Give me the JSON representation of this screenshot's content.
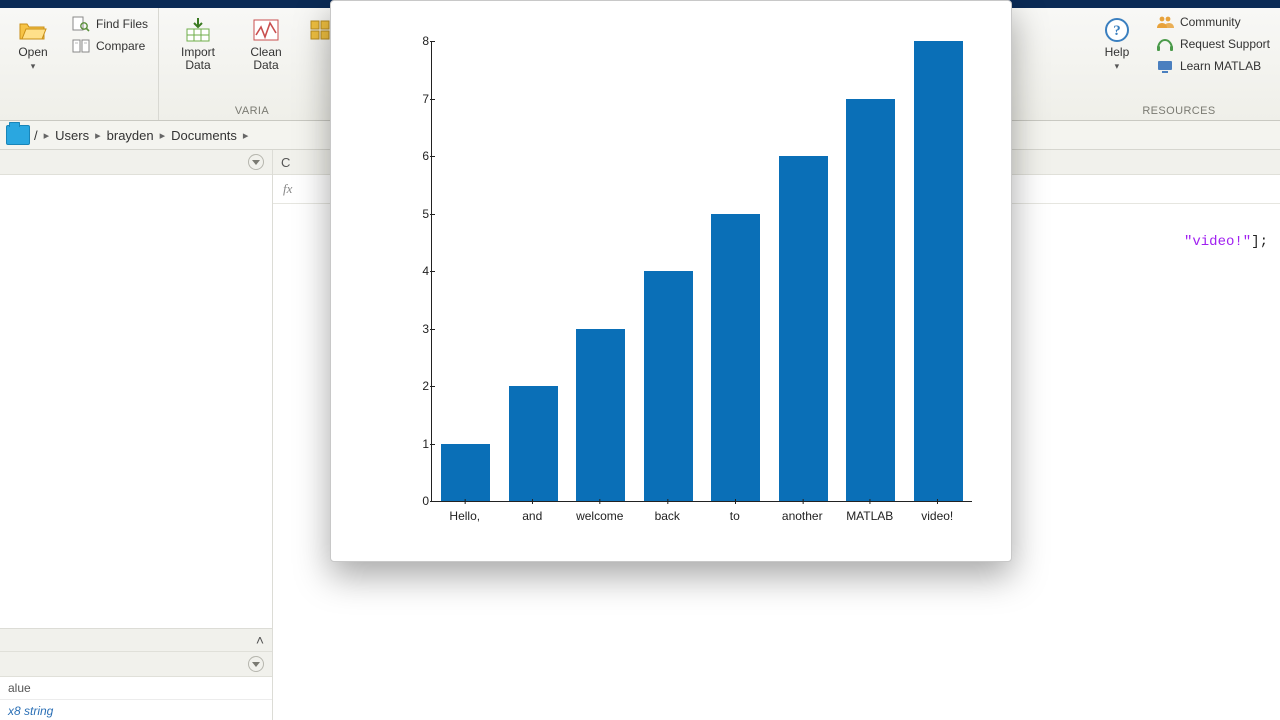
{
  "ribbon": {
    "open": "Open",
    "find_files": "Find Files",
    "compare": "Compare",
    "import_data": "Import\nData",
    "clean_data": "Clean\nData",
    "variable_group": "VARIA",
    "help": "Help",
    "community": "Community",
    "request_support": "Request Support",
    "learn_matlab": "Learn MATLAB",
    "resources_group": "RESOURCES"
  },
  "path": {
    "root": "/",
    "seg1": "Users",
    "seg2": "brayden",
    "seg3": "Documents"
  },
  "command_window_label": "C",
  "fx": "fx",
  "editor_code_suffix_string": "\"video!\"",
  "editor_code_suffix_tail": "];",
  "workspace": {
    "col_value": "alue",
    "var_type": "x8 string"
  },
  "chart_data": {
    "type": "bar",
    "categories": [
      "Hello,",
      "and",
      "welcome",
      "back",
      "to",
      "another",
      "MATLAB",
      "video!"
    ],
    "values": [
      1,
      2,
      3,
      4,
      5,
      6,
      7,
      8
    ],
    "yticks": [
      0,
      1,
      2,
      3,
      4,
      5,
      6,
      7,
      8
    ],
    "ylim": [
      0,
      8
    ],
    "title": "",
    "xlabel": "",
    "ylabel": ""
  }
}
